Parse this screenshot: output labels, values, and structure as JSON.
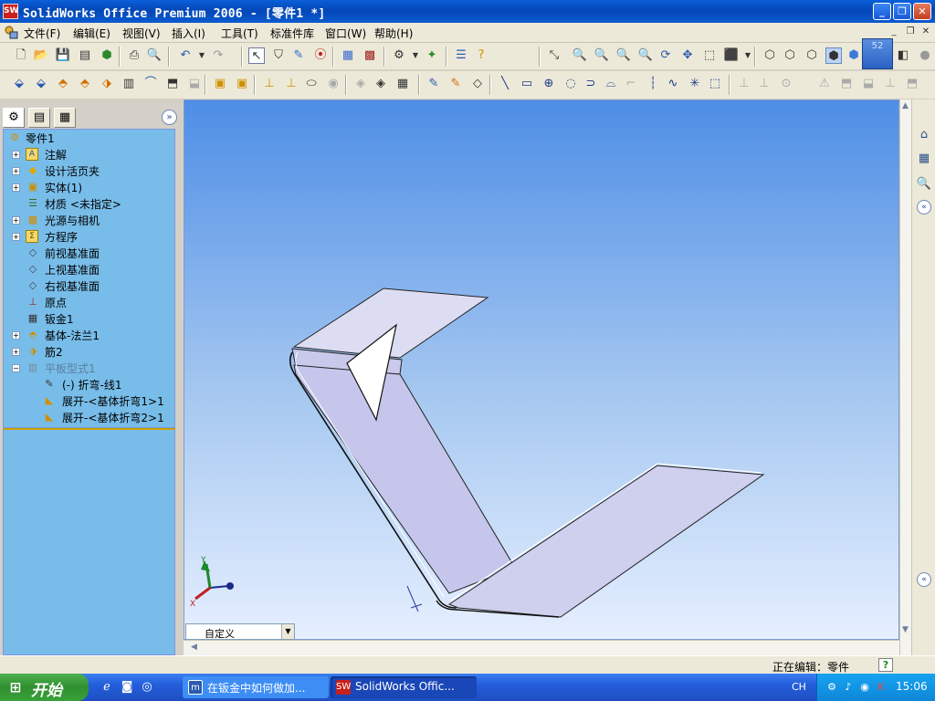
{
  "window": {
    "title": "SolidWorks Office Premium 2006 - [零件1 *]",
    "app_icon": "SW"
  },
  "menu": {
    "items": [
      "文件(F)",
      "编辑(E)",
      "视图(V)",
      "插入(I)",
      "工具(T)",
      "标准件库",
      "窗口(W)",
      "帮助(H)"
    ]
  },
  "toolbar": {
    "zoom_value": "52"
  },
  "tree": {
    "root": "零件1",
    "items": [
      {
        "label": "注解",
        "icon": "annotations-icon",
        "expandable": true
      },
      {
        "label": "设计活页夹",
        "icon": "design-binder-icon",
        "expandable": true
      },
      {
        "label": "实体(1)",
        "icon": "solid-bodies-icon",
        "expandable": true
      },
      {
        "label": "材质 <未指定>",
        "icon": "material-icon",
        "expandable": false
      },
      {
        "label": "光源与相机",
        "icon": "lights-camera-icon",
        "expandable": true
      },
      {
        "label": "方程序",
        "icon": "equations-icon",
        "expandable": true
      },
      {
        "label": "前视基准面",
        "icon": "plane-icon",
        "expandable": false
      },
      {
        "label": "上视基准面",
        "icon": "plane-icon",
        "expandable": false
      },
      {
        "label": "右视基准面",
        "icon": "plane-icon",
        "expandable": false
      },
      {
        "label": "原点",
        "icon": "origin-icon",
        "expandable": false
      },
      {
        "label": "钣金1",
        "icon": "sheetmetal-icon",
        "expandable": false
      },
      {
        "label": "基体-法兰1",
        "icon": "base-flange-icon",
        "expandable": true
      },
      {
        "label": "筋2",
        "icon": "rib-icon",
        "expandable": true
      },
      {
        "label": "平板型式1",
        "icon": "flat-pattern-icon",
        "expandable": true,
        "suppressed": true
      },
      {
        "label": "(-) 折弯-线1",
        "icon": "sketch-icon",
        "child": true
      },
      {
        "label": "展开-<基体折弯1>1",
        "icon": "unfold-icon",
        "child": true
      },
      {
        "label": "展开-<基体折弯2>1",
        "icon": "unfold-icon",
        "child": true
      }
    ]
  },
  "viewport": {
    "view_select": "自定义",
    "triad": {
      "x": "X",
      "y": "Y"
    }
  },
  "status": {
    "editing": "正在编辑：零件",
    "help": "?"
  },
  "taskbar": {
    "start": "开始",
    "tasks": [
      {
        "label": "在钣金中如何做加...",
        "icon": "browser-icon"
      },
      {
        "label": "SolidWorks Offic...",
        "icon": "solidworks-icon"
      }
    ],
    "lang": "CH",
    "clock": "15:06"
  }
}
